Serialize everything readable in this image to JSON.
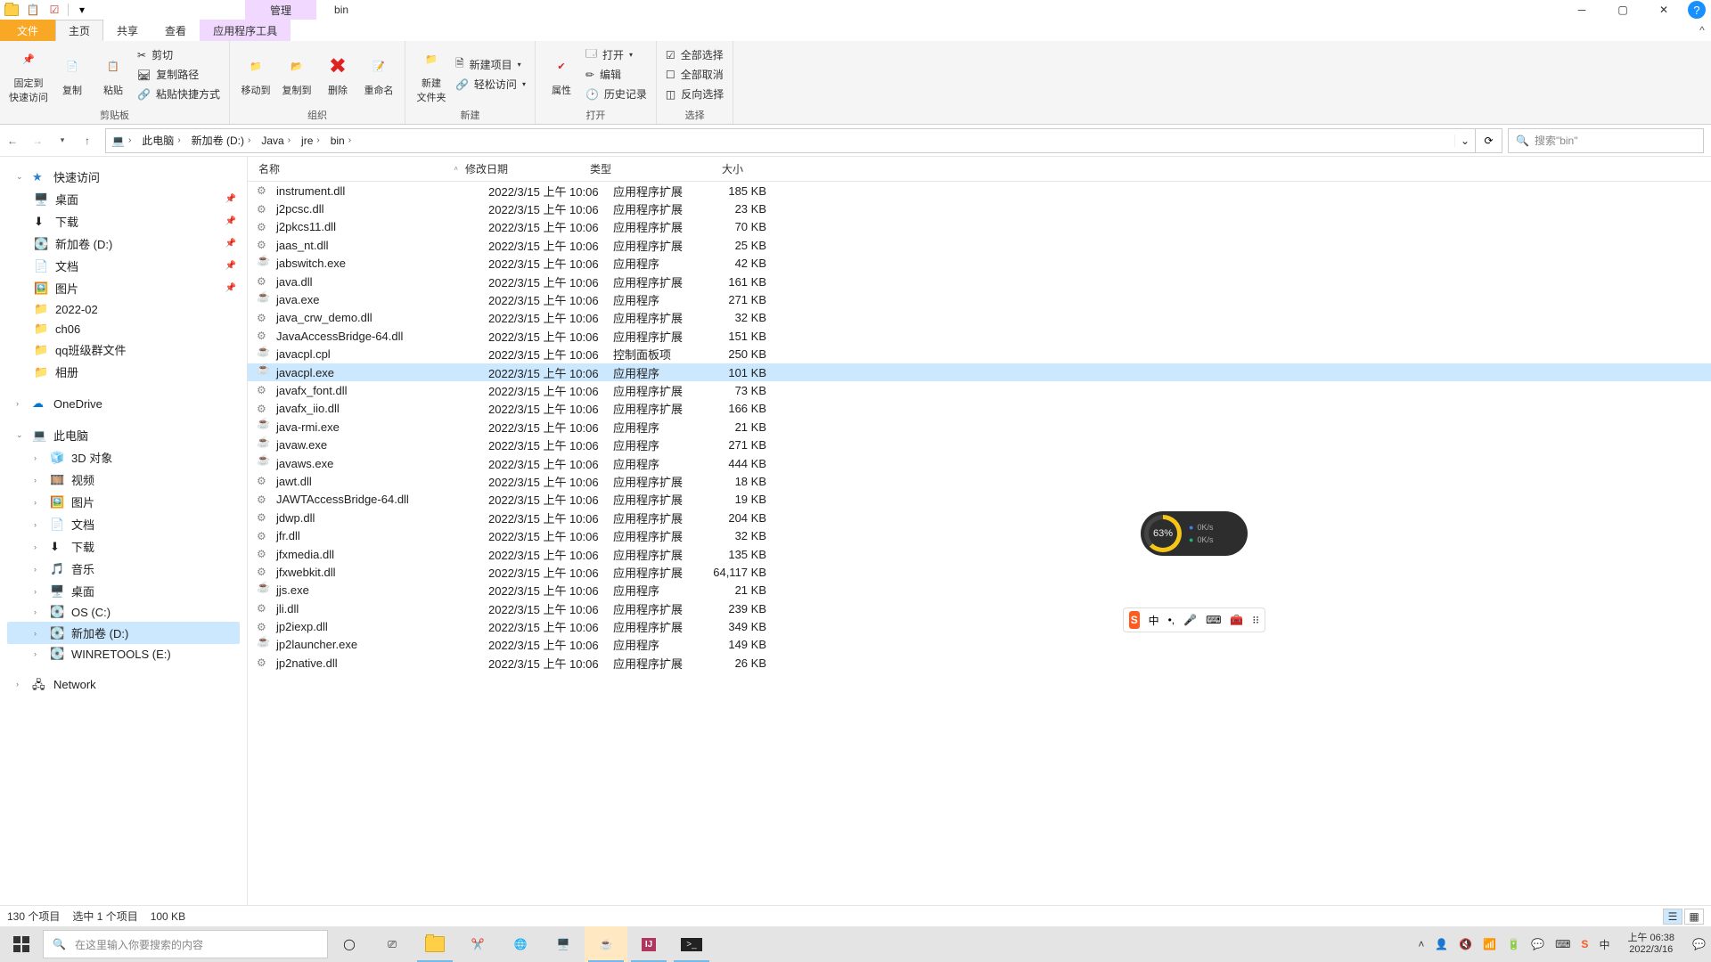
{
  "title_bar": {
    "contextual_tab_title": "管理",
    "window_title": "bin"
  },
  "ribbon": {
    "tabs": {
      "file": "文件",
      "home": "主页",
      "share": "共享",
      "view": "查看",
      "apptools": "应用程序工具"
    },
    "collapse_hint": "^",
    "groups": {
      "clipboard": {
        "label": "剪贴板",
        "pin_to_quick": "固定到\n快速访问",
        "copy": "复制",
        "paste": "粘贴",
        "cut": "剪切",
        "copy_path": "复制路径",
        "paste_shortcut": "粘贴快捷方式"
      },
      "organize": {
        "label": "组织",
        "move_to": "移动到",
        "copy_to": "复制到",
        "delete": "删除",
        "rename": "重命名"
      },
      "new": {
        "label": "新建",
        "new_folder": "新建\n文件夹",
        "new_item": "新建项目",
        "easy_access": "轻松访问"
      },
      "open": {
        "label": "打开",
        "properties": "属性",
        "open": "打开",
        "edit": "编辑",
        "history": "历史记录"
      },
      "select": {
        "label": "选择",
        "select_all": "全部选择",
        "select_none": "全部取消",
        "invert": "反向选择"
      }
    }
  },
  "address": {
    "segments": [
      "此电脑",
      "新加卷 (D:)",
      "Java",
      "jre",
      "bin"
    ],
    "search_placeholder": "搜索\"bin\""
  },
  "nav_pane": {
    "quick_access": "快速访问",
    "quick_items": [
      {
        "label": "桌面",
        "pinned": true,
        "kind": "desktop"
      },
      {
        "label": "下载",
        "pinned": true,
        "kind": "downloads"
      },
      {
        "label": "新加卷 (D:)",
        "pinned": true,
        "kind": "disk"
      },
      {
        "label": "文档",
        "pinned": true,
        "kind": "documents"
      },
      {
        "label": "图片",
        "pinned": true,
        "kind": "pictures"
      },
      {
        "label": "2022-02",
        "pinned": false,
        "kind": "folder"
      },
      {
        "label": "ch06",
        "pinned": false,
        "kind": "folder"
      },
      {
        "label": "qq班级群文件",
        "pinned": false,
        "kind": "folder"
      },
      {
        "label": "相册",
        "pinned": false,
        "kind": "folder"
      }
    ],
    "onedrive": "OneDrive",
    "this_pc": "此电脑",
    "pc_items": [
      {
        "label": "3D 对象",
        "kind": "3d"
      },
      {
        "label": "视频",
        "kind": "videos"
      },
      {
        "label": "图片",
        "kind": "pictures"
      },
      {
        "label": "文档",
        "kind": "documents"
      },
      {
        "label": "下载",
        "kind": "downloads"
      },
      {
        "label": "音乐",
        "kind": "music"
      },
      {
        "label": "桌面",
        "kind": "desktop"
      },
      {
        "label": "OS (C:)",
        "kind": "disk"
      },
      {
        "label": "新加卷 (D:)",
        "kind": "disk",
        "selected": true
      },
      {
        "label": "WINRETOOLS (E:)",
        "kind": "disk"
      }
    ],
    "network": "Network"
  },
  "columns": {
    "name": "名称",
    "date": "修改日期",
    "type": "类型",
    "size": "大小"
  },
  "files": [
    {
      "name": "instrument.dll",
      "date": "2022/3/15 上午 10:06",
      "type": "应用程序扩展",
      "size": "185 KB",
      "icon": "dll"
    },
    {
      "name": "j2pcsc.dll",
      "date": "2022/3/15 上午 10:06",
      "type": "应用程序扩展",
      "size": "23 KB",
      "icon": "dll"
    },
    {
      "name": "j2pkcs11.dll",
      "date": "2022/3/15 上午 10:06",
      "type": "应用程序扩展",
      "size": "70 KB",
      "icon": "dll"
    },
    {
      "name": "jaas_nt.dll",
      "date": "2022/3/15 上午 10:06",
      "type": "应用程序扩展",
      "size": "25 KB",
      "icon": "dll"
    },
    {
      "name": "jabswitch.exe",
      "date": "2022/3/15 上午 10:06",
      "type": "应用程序",
      "size": "42 KB",
      "icon": "java"
    },
    {
      "name": "java.dll",
      "date": "2022/3/15 上午 10:06",
      "type": "应用程序扩展",
      "size": "161 KB",
      "icon": "dll"
    },
    {
      "name": "java.exe",
      "date": "2022/3/15 上午 10:06",
      "type": "应用程序",
      "size": "271 KB",
      "icon": "java"
    },
    {
      "name": "java_crw_demo.dll",
      "date": "2022/3/15 上午 10:06",
      "type": "应用程序扩展",
      "size": "32 KB",
      "icon": "dll"
    },
    {
      "name": "JavaAccessBridge-64.dll",
      "date": "2022/3/15 上午 10:06",
      "type": "应用程序扩展",
      "size": "151 KB",
      "icon": "dll"
    },
    {
      "name": "javacpl.cpl",
      "date": "2022/3/15 上午 10:06",
      "type": "控制面板项",
      "size": "250 KB",
      "icon": "java"
    },
    {
      "name": "javacpl.exe",
      "date": "2022/3/15 上午 10:06",
      "type": "应用程序",
      "size": "101 KB",
      "icon": "java",
      "selected": true
    },
    {
      "name": "javafx_font.dll",
      "date": "2022/3/15 上午 10:06",
      "type": "应用程序扩展",
      "size": "73 KB",
      "icon": "dll"
    },
    {
      "name": "javafx_iio.dll",
      "date": "2022/3/15 上午 10:06",
      "type": "应用程序扩展",
      "size": "166 KB",
      "icon": "dll"
    },
    {
      "name": "java-rmi.exe",
      "date": "2022/3/15 上午 10:06",
      "type": "应用程序",
      "size": "21 KB",
      "icon": "java"
    },
    {
      "name": "javaw.exe",
      "date": "2022/3/15 上午 10:06",
      "type": "应用程序",
      "size": "271 KB",
      "icon": "java"
    },
    {
      "name": "javaws.exe",
      "date": "2022/3/15 上午 10:06",
      "type": "应用程序",
      "size": "444 KB",
      "icon": "java"
    },
    {
      "name": "jawt.dll",
      "date": "2022/3/15 上午 10:06",
      "type": "应用程序扩展",
      "size": "18 KB",
      "icon": "dll"
    },
    {
      "name": "JAWTAccessBridge-64.dll",
      "date": "2022/3/15 上午 10:06",
      "type": "应用程序扩展",
      "size": "19 KB",
      "icon": "dll"
    },
    {
      "name": "jdwp.dll",
      "date": "2022/3/15 上午 10:06",
      "type": "应用程序扩展",
      "size": "204 KB",
      "icon": "dll"
    },
    {
      "name": "jfr.dll",
      "date": "2022/3/15 上午 10:06",
      "type": "应用程序扩展",
      "size": "32 KB",
      "icon": "dll"
    },
    {
      "name": "jfxmedia.dll",
      "date": "2022/3/15 上午 10:06",
      "type": "应用程序扩展",
      "size": "135 KB",
      "icon": "dll"
    },
    {
      "name": "jfxwebkit.dll",
      "date": "2022/3/15 上午 10:06",
      "type": "应用程序扩展",
      "size": "64,117 KB",
      "icon": "dll"
    },
    {
      "name": "jjs.exe",
      "date": "2022/3/15 上午 10:06",
      "type": "应用程序",
      "size": "21 KB",
      "icon": "java"
    },
    {
      "name": "jli.dll",
      "date": "2022/3/15 上午 10:06",
      "type": "应用程序扩展",
      "size": "239 KB",
      "icon": "dll"
    },
    {
      "name": "jp2iexp.dll",
      "date": "2022/3/15 上午 10:06",
      "type": "应用程序扩展",
      "size": "349 KB",
      "icon": "dll"
    },
    {
      "name": "jp2launcher.exe",
      "date": "2022/3/15 上午 10:06",
      "type": "应用程序",
      "size": "149 KB",
      "icon": "java"
    },
    {
      "name": "jp2native.dll",
      "date": "2022/3/15 上午 10:06",
      "type": "应用程序扩展",
      "size": "26 KB",
      "icon": "dll"
    }
  ],
  "status": {
    "items": "130 个项目",
    "selection": "选中 1 个项目",
    "sel_size": "100 KB"
  },
  "taskbar": {
    "search_placeholder": "在这里输入你要搜索的内容",
    "clock_time": "上午 06:38",
    "clock_date": "2022/3/16"
  },
  "perf": {
    "percent": "63%",
    "down": "0K/s",
    "up": "0K/s"
  },
  "ime": {
    "lang": "中"
  }
}
